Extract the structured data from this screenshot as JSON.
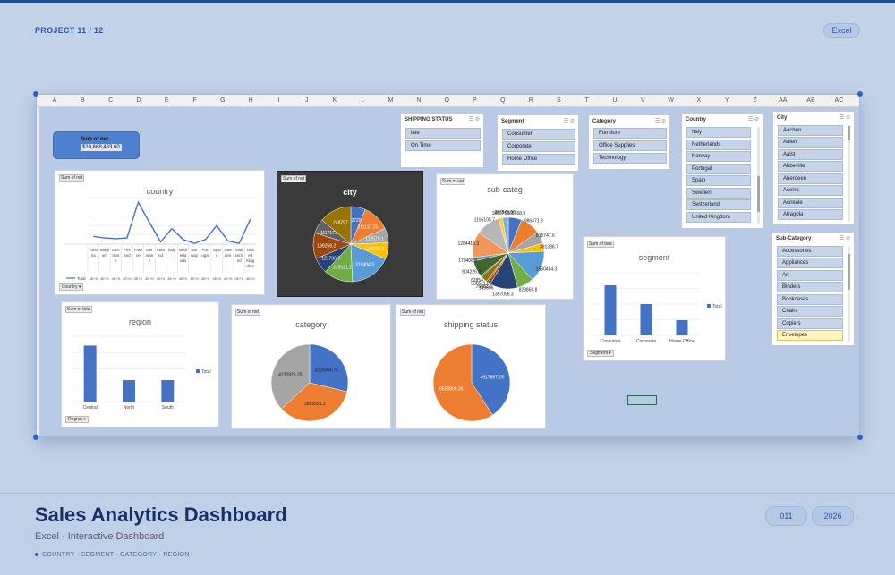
{
  "header": {
    "project": "PROJECT  11 / 12",
    "app_badge": "Excel"
  },
  "sheet": {
    "columns": [
      "A",
      "B",
      "C",
      "D",
      "E",
      "F",
      "G",
      "H",
      "I",
      "J",
      "K",
      "L",
      "M",
      "N",
      "O",
      "P",
      "Q",
      "R",
      "S",
      "T",
      "U",
      "V",
      "W",
      "X",
      "Y",
      "Z",
      "AA",
      "AB",
      "AC"
    ]
  },
  "kpi": {
    "label": "Sum of net",
    "value": "$10,668,463.60"
  },
  "slicers": {
    "shipping": {
      "title": "SHIPPING STATUS",
      "items": [
        "late",
        "On Time"
      ]
    },
    "segment": {
      "title": "Segment",
      "items": [
        "Consumer",
        "Corporate",
        "Home Office"
      ]
    },
    "category": {
      "title": "Category",
      "items": [
        "Furniture",
        "Office Supplies",
        "Technology"
      ]
    },
    "country": {
      "title": "Country",
      "items": [
        "Italy",
        "Netherlands",
        "Norway",
        "Portugal",
        "Spain",
        "Sweden",
        "Switzerland",
        "United Kingdom"
      ]
    },
    "city": {
      "title": "City",
      "items": [
        "Aachen",
        "Aalen",
        "Aalst",
        "Abbeville",
        "Aberdeen",
        "Acerra",
        "Acireale",
        "Afragola"
      ]
    },
    "subcategory": {
      "title": "Sub-Category",
      "items": [
        "Accessories",
        "Appliances",
        "Art",
        "Binders",
        "Bookcases",
        "Chairs",
        "Copiers",
        "Envelopes"
      ]
    }
  },
  "charts": {
    "country": {
      "tag": "Sum of net",
      "title": "country",
      "filter": "Country",
      "legend_label": "Total",
      "table_values": "4E+0",
      "chart_data": {
        "type": "line",
        "title": "country",
        "categories": [
          "Austria",
          "Belgium",
          "Denmark",
          "Finland",
          "France",
          "Germany",
          "Ireland",
          "Italy",
          "Netherlands",
          "Norway",
          "Portugal",
          "Spain",
          "Sweden",
          "Switzerland",
          "United Kingdom"
        ],
        "category_labels": [
          "Aust ria",
          "Belgi um",
          "Den mar k",
          "Finl and",
          "Fran ce",
          "Ger man y",
          "Irela nd",
          "Italy",
          "Neth erla nds",
          "Nor way",
          "Port ugal",
          "Spai n",
          "Swe den",
          "Swit zerla nd",
          "Unit ed King dom"
        ],
        "series": [
          {
            "name": "Total",
            "values": [
              0.5,
              0.4,
              0.35,
              0.4,
              2.7,
              1.4,
              0.15,
              1.0,
              0.3,
              0.05,
              0.3,
              1.2,
              0.2,
              0.05,
              1.6
            ]
          }
        ],
        "ylim": [
          0,
          3
        ],
        "legend": "bottom"
      }
    },
    "city": {
      "tag": "Sum of net",
      "title": "city",
      "chart_data": {
        "type": "pie",
        "title": "city",
        "slices": [
          {
            "label": "112729.9",
            "value": 112729.9,
            "color": "#4472c4"
          },
          {
            "label": "211137.25",
            "value": 211137.25,
            "color": "#ed7d31"
          },
          {
            "label": "112575.1",
            "value": 112575.1,
            "color": "#a5a5a5"
          },
          {
            "label": "125560.3",
            "value": 125560.3,
            "color": "#ffc000"
          },
          {
            "label": "319404.3",
            "value": 319404.3,
            "color": "#5b9bd5"
          },
          {
            "label": "225121.2",
            "value": 225121.2,
            "color": "#70ad47"
          },
          {
            "label": "121736.7",
            "value": 121736.7,
            "color": "#264478"
          },
          {
            "label": "199258.2",
            "value": 199258.2,
            "color": "#9e480e"
          },
          {
            "label": "111717.5",
            "value": 111717.5,
            "color": "#636363"
          },
          {
            "label": "248757",
            "value": 248757,
            "color": "#997300"
          }
        ]
      }
    },
    "subcategory": {
      "tag": "Sum of net",
      "title": "sub-categ",
      "chart_data": {
        "type": "pie",
        "title": "sub-categ",
        "slices": [
          {
            "label": "665168.9",
            "value": 665168.9,
            "color": "#4472c4"
          },
          {
            "label": "986471.8",
            "value": 986471.8,
            "color": "#ed7d31"
          },
          {
            "label": "615747.6",
            "value": 615747.6,
            "color": "#a5a5a5"
          },
          {
            "label": "391388.7",
            "value": 391388.7,
            "color": "#ffc000"
          },
          {
            "label": "1550484.3",
            "value": 1550484.3,
            "color": "#5b9bd5"
          },
          {
            "label": "823866.8",
            "value": 823866.8,
            "color": "#70ad47"
          },
          {
            "label": "1387096.3",
            "value": 1387096.3,
            "color": "#264478"
          },
          {
            "label": "149806",
            "value": 149806,
            "color": "#9e480e"
          },
          {
            "label": "76683.7",
            "value": 76683.7,
            "color": "#636363"
          },
          {
            "label": "330511.8",
            "value": 330511.8,
            "color": "#997300"
          },
          {
            "label": "62854",
            "value": 62854,
            "color": "#255e91"
          },
          {
            "label": "804226.2",
            "value": 804226.2,
            "color": "#43682b"
          },
          {
            "label": "179408.8",
            "value": 179408.8,
            "color": "#698ed0"
          },
          {
            "label": "1284415.3",
            "value": 1284415.3,
            "color": "#f1975a"
          },
          {
            "label": "1195105.7",
            "value": 1195105.7,
            "color": "#b7b7b7"
          },
          {
            "label": "198075",
            "value": 198075,
            "color": "#ffcd33"
          },
          {
            "label": "287573.55",
            "value": 287573.55,
            "color": "#7cafdd"
          }
        ]
      }
    },
    "segment": {
      "tag": "Sum of tota",
      "title": "segment",
      "filter": "Segment",
      "legend_label": "Total",
      "chart_data": {
        "type": "bar",
        "title": "segment",
        "categories": [
          "Consumer",
          "Corporate",
          "Home Office"
        ],
        "series": [
          {
            "name": "Total",
            "values": [
              5.6,
              3.5,
              1.7
            ]
          }
        ],
        "ylim": [
          0,
          7
        ],
        "legend": "right"
      }
    },
    "region": {
      "tag": "Sum of tota",
      "title": "region",
      "filter": "Region",
      "legend_label": "Total",
      "chart_data": {
        "type": "bar",
        "title": "region",
        "categories": [
          "Central",
          "North",
          "South"
        ],
        "series": [
          {
            "name": "Total",
            "values": [
              6.0,
              2.3,
              2.3
            ]
          }
        ],
        "ylim": [
          0,
          7
        ],
        "legend": "right"
      }
    },
    "category": {
      "tag": "Sum of net",
      "title": "category",
      "chart_data": {
        "type": "pie",
        "title": "category",
        "slices": [
          {
            "label": "3226004.75",
            "value": 3226004.75,
            "color": "#4472c4"
          },
          {
            "label": "3855521.2",
            "value": 3855521.2,
            "color": "#ed7d31"
          },
          {
            "label": "4130925.25",
            "value": 4130925.25,
            "color": "#a5a5a5"
          }
        ]
      }
    },
    "shipping": {
      "tag": "Sum of net",
      "title": "shipping status",
      "chart_data": {
        "type": "pie",
        "title": "shipping status",
        "slices": [
          {
            "label": "4517957.25",
            "value": 4517957.25,
            "color": "#4472c4"
          },
          {
            "label": "6550806.35",
            "value": 6550806.35,
            "color": "#ed7d31"
          }
        ]
      }
    }
  },
  "footer": {
    "title": "Sales Analytics Dashboard",
    "tool": "Excel",
    "kind": "Interactive Dashboard",
    "keywords": "COUNTRY · SEGMENT · CATEGORY · REGION",
    "badge_num": "011",
    "badge_year": "2026"
  }
}
